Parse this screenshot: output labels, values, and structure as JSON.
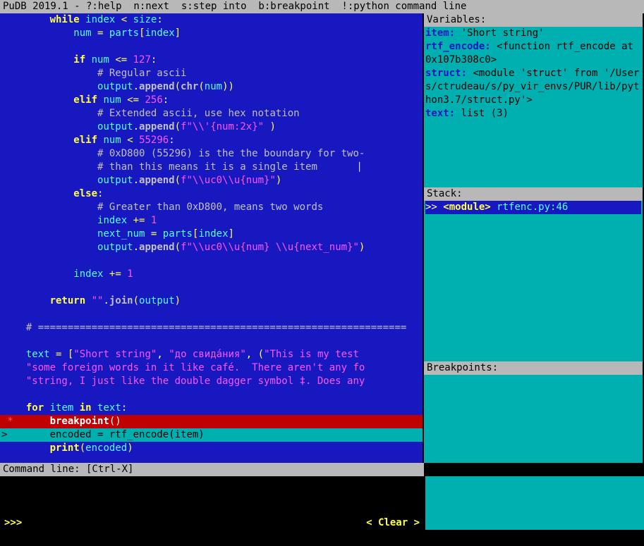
{
  "titlebar": "PuDB 2019.1 - ?:help  n:next  s:step into  b:breakpoint  !:python command line",
  "code": {
    "lines": [
      {
        "gutter": "  ",
        "html": "      <span class='kw'>while</span> <span class='id'>index</span> <span class='op'>&lt;</span> <span class='id'>size</span><span class='plain'>:</span>"
      },
      {
        "gutter": "  ",
        "html": "          <span class='id'>num</span> <span class='op'>=</span> <span class='id'>parts</span><span class='paren'>[</span><span class='id'>index</span><span class='paren'>]</span>"
      },
      {
        "gutter": "  ",
        "html": ""
      },
      {
        "gutter": "  ",
        "html": "          <span class='kw'>if</span> <span class='id'>num</span> <span class='op'>&lt;=</span> <span class='num'>127</span><span class='plain'>:</span>"
      },
      {
        "gutter": "  ",
        "html": "              <span class='comment'># Regular ascii</span>"
      },
      {
        "gutter": "  ",
        "html": "              <span class='id'>output</span><span class='plain'>.</span><span class='fn'>append</span><span class='paren'>(</span><span class='fn'>chr</span><span class='paren'>(</span><span class='id'>num</span><span class='paren'>))</span>"
      },
      {
        "gutter": "  ",
        "html": "          <span class='kw'>elif</span> <span class='id'>num</span> <span class='op'>&lt;=</span> <span class='num'>256</span><span class='plain'>:</span>"
      },
      {
        "gutter": "  ",
        "html": "              <span class='comment'># Extended ascii, use hex notation</span>"
      },
      {
        "gutter": "  ",
        "html": "              <span class='id'>output</span><span class='plain'>.</span><span class='fn'>append</span><span class='paren'>(</span><span class='str'>f\"\\\\'{num:2x}\"</span> <span class='paren'>)</span>"
      },
      {
        "gutter": "  ",
        "html": "          <span class='kw'>elif</span> <span class='id'>num</span> <span class='op'>&lt;</span> <span class='num'>55296</span><span class='plain'>:</span>"
      },
      {
        "gutter": "  ",
        "html": "              <span class='comment'># 0xD800 (55296) is the the boundary for two-</span>"
      },
      {
        "gutter": "  ",
        "html": "              <span class='comment'># than this means it is a single item       </span><span class='plain'>⎸</span>"
      },
      {
        "gutter": "  ",
        "html": "              <span class='id'>output</span><span class='plain'>.</span><span class='fn'>append</span><span class='paren'>(</span><span class='str'>f\"\\\\uc0\\\\u{num}\"</span><span class='paren'>)</span>"
      },
      {
        "gutter": "  ",
        "html": "          <span class='kw'>else</span><span class='plain'>:</span>"
      },
      {
        "gutter": "  ",
        "html": "              <span class='comment'># Greater than 0xD800, means two words</span>"
      },
      {
        "gutter": "  ",
        "html": "              <span class='id'>index</span> <span class='op'>+=</span> <span class='num'>1</span>"
      },
      {
        "gutter": "  ",
        "html": "              <span class='id'>next_num</span> <span class='op'>=</span> <span class='id'>parts</span><span class='paren'>[</span><span class='id'>index</span><span class='paren'>]</span>"
      },
      {
        "gutter": "  ",
        "html": "              <span class='id'>output</span><span class='plain'>.</span><span class='fn'>append</span><span class='paren'>(</span><span class='str'>f\"\\\\uc0\\\\u{num} \\\\u{next_num}\"</span><span class='paren'>)</span>"
      },
      {
        "gutter": "  ",
        "html": ""
      },
      {
        "gutter": "  ",
        "html": "          <span class='id'>index</span> <span class='op'>+=</span> <span class='num'>1</span>"
      },
      {
        "gutter": "  ",
        "html": ""
      },
      {
        "gutter": "  ",
        "html": "      <span class='kw'>return</span> <span class='str'>\"\"</span><span class='plain'>.</span><span class='fn'>join</span><span class='paren'>(</span><span class='id'>output</span><span class='paren'>)</span>"
      },
      {
        "gutter": "  ",
        "html": ""
      },
      {
        "gutter": "  ",
        "html": "  <span class='comment'># ==============================================================</span>"
      },
      {
        "gutter": "  ",
        "html": ""
      },
      {
        "gutter": "  ",
        "html": "  <span class='id'>text</span> <span class='op'>=</span> <span class='paren'>[</span><span class='str'>\"Short string\"</span><span class='plain'>,</span> <span class='str'>\"до свида́ния\"</span><span class='plain'>,</span> <span class='paren'>(</span><span class='str'>\"This is my test </span>"
      },
      {
        "gutter": "  ",
        "html": "  <span class='str'>\"some foreign words in it like café.  There aren't any fo</span>"
      },
      {
        "gutter": "  ",
        "html": "  <span class='str'>\"string, I just like the double dagger symbol ‡. Does any</span>"
      },
      {
        "gutter": "  ",
        "html": ""
      },
      {
        "gutter": "  ",
        "html": "  <span class='kw'>for</span> <span class='id'>item</span> <span class='kw'>in</span> <span class='id'>text</span><span class='plain'>:</span>"
      },
      {
        "gutter": " *",
        "cls": "bp-line",
        "html": "      <span class='fn' style='color:#fff'>breakpoint</span><span class='paren' style='color:#fff'>()</span>"
      },
      {
        "gutter": "> ",
        "cls": "cur-line",
        "html": "      <span>encoded = rtf_encode(item)</span>"
      },
      {
        "gutter": "  ",
        "html": "      <span class='kw'>print</span><span class='paren'>(</span><span class='id'>encoded</span><span class='paren'>)</span>"
      }
    ]
  },
  "variables": {
    "header": "Variables:",
    "items": [
      {
        "name": "item:",
        "value": " 'Short string'"
      },
      {
        "name": "rtf_encode:",
        "value": " <function rtf_encode at 0x107b308c0>"
      },
      {
        "name": "struct:",
        "value": " <module 'struct' from '/Users/ctrudeau/s/py_vir_envs/PUR/lib/python3.7/struct.py'>"
      },
      {
        "name": "text:",
        "value": " list (3)"
      }
    ]
  },
  "stack": {
    "header": "Stack:",
    "line_prefix": ">> ",
    "module": "<module>",
    "location": " rtfenc.py:46"
  },
  "breakpoints": {
    "header": "Breakpoints:"
  },
  "cmdline": {
    "header": "Command line: [Ctrl-X]",
    "prompt": ">>>",
    "clear": "< Clear >"
  }
}
